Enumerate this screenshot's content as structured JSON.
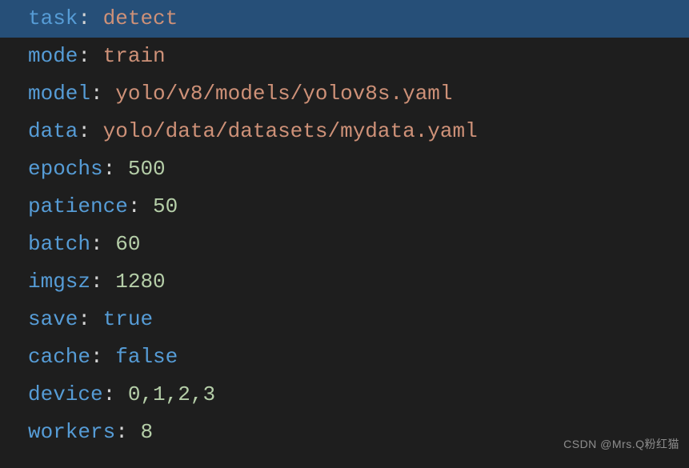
{
  "lines": [
    {
      "key": "task",
      "value": "detect",
      "type": "str",
      "highlight": true
    },
    {
      "key": "mode",
      "value": "train",
      "type": "str",
      "highlight": false
    },
    {
      "key": "model",
      "value": "yolo/v8/models/yolov8s.yaml",
      "type": "str",
      "highlight": false
    },
    {
      "key": "data",
      "value": "yolo/data/datasets/mydata.yaml",
      "type": "str",
      "highlight": false
    },
    {
      "key": "epochs",
      "value": "500",
      "type": "num",
      "highlight": false
    },
    {
      "key": "patience",
      "value": "50",
      "type": "num",
      "highlight": false
    },
    {
      "key": "batch",
      "value": "60",
      "type": "num",
      "highlight": false
    },
    {
      "key": "imgsz",
      "value": "1280",
      "type": "num",
      "highlight": false
    },
    {
      "key": "save",
      "value": "true",
      "type": "kw",
      "highlight": false
    },
    {
      "key": "cache",
      "value": "false",
      "type": "kw",
      "highlight": false
    },
    {
      "key": "device",
      "value": "0,1,2,3",
      "type": "num",
      "highlight": false
    },
    {
      "key": "workers",
      "value": "8",
      "type": "num",
      "highlight": false
    }
  ],
  "colon": ": ",
  "watermark": "CSDN @Mrs.Q粉红猫"
}
